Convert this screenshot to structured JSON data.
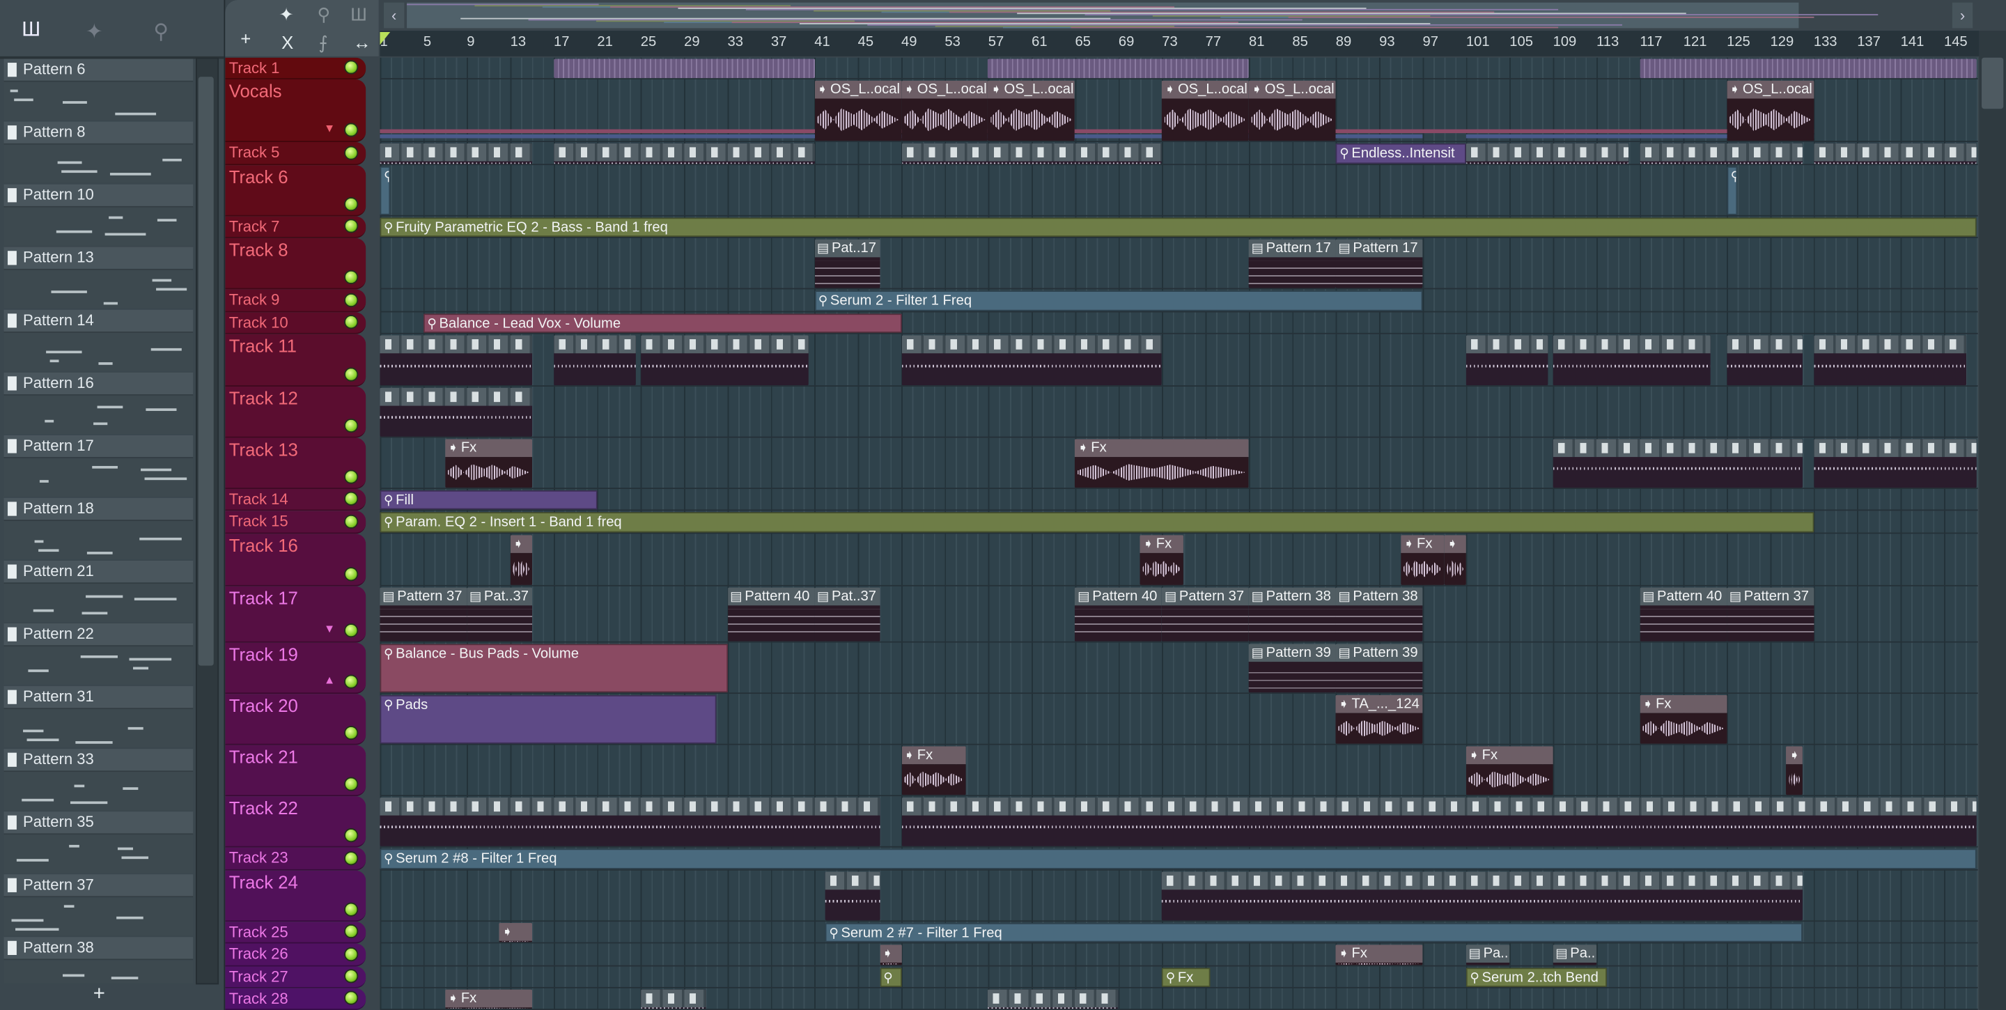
{
  "browser": {
    "tab_icons": [
      "piano-roll-icon",
      "audio-wave-icon",
      "automation-icon"
    ],
    "add_label": "+",
    "patterns": [
      "Pattern 6",
      "Pattern 8",
      "Pattern 10",
      "Pattern 13",
      "Pattern 14",
      "Pattern 16",
      "Pattern 17",
      "Pattern 18",
      "Pattern 21",
      "Pattern 22",
      "Pattern 31",
      "Pattern 33",
      "Pattern 35",
      "Pattern 37",
      "Pattern 38"
    ]
  },
  "toolbar": {
    "add": "+",
    "cut": "X",
    "slide": "⨍",
    "stretch": "↔",
    "wave": "✦",
    "auto": "⚲",
    "piano": "Ш",
    "scroll_left": "‹",
    "scroll_right": "›"
  },
  "ruler": {
    "labels": [
      1,
      5,
      9,
      13,
      17,
      21,
      25,
      29,
      33,
      37,
      41,
      45,
      49,
      53,
      57,
      61,
      65,
      69,
      73,
      77,
      81,
      85,
      89,
      93,
      97,
      101,
      105,
      109,
      113,
      117,
      121,
      125,
      129,
      133,
      137,
      141,
      145
    ]
  },
  "colors": {
    "auto_olive": "#6e7d47",
    "auto_steel": "#4a6a7e",
    "auto_pink": "#8a4a62",
    "auto_purple": "#5e4a86",
    "audio_strip": "#6a5a80"
  },
  "tracks": [
    {
      "name": "Track 1"
    },
    {
      "name": "Vocals",
      "arrow": "▼"
    },
    {
      "name": "Track 5"
    },
    {
      "name": "Track 6"
    },
    {
      "name": "Track 7"
    },
    {
      "name": "Track 8"
    },
    {
      "name": "Track 9"
    },
    {
      "name": "Track 10"
    },
    {
      "name": "Track 11"
    },
    {
      "name": "Track 12"
    },
    {
      "name": "Track 13"
    },
    {
      "name": "Track 14"
    },
    {
      "name": "Track 15"
    },
    {
      "name": "Track 16"
    },
    {
      "name": "Track 17",
      "arrow": "▼"
    },
    {
      "name": "Track 19",
      "arrow": "▲"
    },
    {
      "name": "Track 20"
    },
    {
      "name": "Track 21"
    },
    {
      "name": "Track 22"
    },
    {
      "name": "Track 23"
    },
    {
      "name": "Track 24"
    },
    {
      "name": "Track 25"
    },
    {
      "name": "Track 26"
    },
    {
      "name": "Track 27"
    },
    {
      "name": "Track 28"
    }
  ],
  "clips": [
    {
      "t": 0,
      "s": 17,
      "l": 24,
      "type": "strip",
      "label": ""
    },
    {
      "t": 0,
      "s": 57,
      "l": 24,
      "type": "strip",
      "label": ""
    },
    {
      "t": 0,
      "s": 117,
      "l": 31,
      "type": "strip",
      "label": ""
    },
    {
      "t": 1,
      "s": 41,
      "l": 8,
      "type": "audio",
      "label": "OS_L..ocal"
    },
    {
      "t": 1,
      "s": 49,
      "l": 8,
      "type": "audio",
      "label": "OS_L..ocal"
    },
    {
      "t": 1,
      "s": 57,
      "l": 8,
      "type": "audio",
      "label": "OS_L..ocal"
    },
    {
      "t": 1,
      "s": 73,
      "l": 8,
      "type": "audio",
      "label": "OS_L..ocal"
    },
    {
      "t": 1,
      "s": 81,
      "l": 8,
      "type": "audio",
      "label": "OS_L..ocal"
    },
    {
      "t": 1,
      "s": 125,
      "l": 8,
      "type": "audio",
      "label": "OS_L..ocal"
    },
    {
      "t": 2,
      "s": 1,
      "l": 14,
      "type": "blocks",
      "label": ""
    },
    {
      "t": 2,
      "s": 17,
      "l": 24,
      "type": "blocks",
      "label": ""
    },
    {
      "t": 2,
      "s": 49,
      "l": 24,
      "type": "blocks",
      "label": ""
    },
    {
      "t": 2,
      "s": 89,
      "l": 12,
      "type": "auto",
      "color": "auto_purple",
      "label": "Endless..Intensit"
    },
    {
      "t": 2,
      "s": 101,
      "l": 15,
      "type": "blocks",
      "label": ""
    },
    {
      "t": 2,
      "s": 117,
      "l": 15,
      "type": "blocks",
      "label": ""
    },
    {
      "t": 2,
      "s": 133,
      "l": 15,
      "type": "blocks",
      "label": ""
    },
    {
      "t": 3,
      "s": 1,
      "l": 1,
      "type": "auto",
      "color": "auto_steel",
      "label": ""
    },
    {
      "t": 3,
      "s": 125,
      "l": 1,
      "type": "auto",
      "color": "auto_steel",
      "label": ""
    },
    {
      "t": 4,
      "s": 1,
      "l": 147,
      "type": "auto",
      "color": "auto_olive",
      "label": "Fruity Parametric EQ 2 - Bass - Band 1 freq"
    },
    {
      "t": 5,
      "s": 41,
      "l": 6,
      "type": "pat",
      "label": "Pat..17"
    },
    {
      "t": 5,
      "s": 81,
      "l": 8,
      "type": "pat",
      "label": "Pattern 17"
    },
    {
      "t": 5,
      "s": 89,
      "l": 8,
      "type": "pat",
      "label": "Pattern 17"
    },
    {
      "t": 6,
      "s": 41,
      "l": 56,
      "type": "auto",
      "color": "auto_steel",
      "label": "Serum 2 - Filter 1 Freq"
    },
    {
      "t": 7,
      "s": 5,
      "l": 44,
      "type": "auto",
      "color": "auto_pink",
      "label": "Balance - Lead Vox - Volume"
    },
    {
      "t": 8,
      "s": 1,
      "l": 14,
      "type": "blocks",
      "label": ""
    },
    {
      "t": 8,
      "s": 17,
      "l": 7.5,
      "type": "blocks",
      "label": ""
    },
    {
      "t": 8,
      "s": 25,
      "l": 15.5,
      "type": "blocks",
      "label": ""
    },
    {
      "t": 8,
      "s": 49,
      "l": 24,
      "type": "blocks",
      "label": ""
    },
    {
      "t": 8,
      "s": 101,
      "l": 7.5,
      "type": "blocks",
      "label": ""
    },
    {
      "t": 8,
      "s": 109,
      "l": 14.5,
      "type": "blocks",
      "label": ""
    },
    {
      "t": 8,
      "s": 125,
      "l": 7,
      "type": "blocks",
      "label": ""
    },
    {
      "t": 8,
      "s": 133,
      "l": 14,
      "type": "blocks",
      "label": ""
    },
    {
      "t": 9,
      "s": 1,
      "l": 14,
      "type": "blocks",
      "label": ""
    },
    {
      "t": 10,
      "s": 7,
      "l": 8,
      "type": "audio",
      "label": "Fx"
    },
    {
      "t": 10,
      "s": 65,
      "l": 16,
      "type": "audio",
      "label": "Fx"
    },
    {
      "t": 10,
      "s": 109,
      "l": 23,
      "type": "blocks",
      "label": ""
    },
    {
      "t": 10,
      "s": 133,
      "l": 15,
      "type": "blocks",
      "label": ""
    },
    {
      "t": 11,
      "s": 1,
      "l": 20,
      "type": "auto",
      "color": "auto_purple",
      "label": "Fill"
    },
    {
      "t": 12,
      "s": 1,
      "l": 132,
      "type": "auto",
      "color": "auto_olive",
      "label": "Param. EQ 2 - Insert 1 - Band 1 freq"
    },
    {
      "t": 13,
      "s": 13,
      "l": 2,
      "type": "audio",
      "label": ""
    },
    {
      "t": 13,
      "s": 71,
      "l": 4,
      "type": "audio",
      "label": "Fx"
    },
    {
      "t": 13,
      "s": 95,
      "l": 4,
      "type": "audio",
      "label": "Fx"
    },
    {
      "t": 13,
      "s": 99,
      "l": 2,
      "type": "audio",
      "label": ""
    },
    {
      "t": 14,
      "s": 1,
      "l": 8,
      "type": "pat",
      "label": "Pattern 37"
    },
    {
      "t": 14,
      "s": 9,
      "l": 6,
      "type": "pat",
      "label": "Pat..37"
    },
    {
      "t": 14,
      "s": 33,
      "l": 8,
      "type": "pat",
      "label": "Pattern 40"
    },
    {
      "t": 14,
      "s": 41,
      "l": 6,
      "type": "pat",
      "label": "Pat..37"
    },
    {
      "t": 14,
      "s": 65,
      "l": 8,
      "type": "pat",
      "label": "Pattern 40"
    },
    {
      "t": 14,
      "s": 73,
      "l": 8,
      "type": "pat",
      "label": "Pattern 37"
    },
    {
      "t": 14,
      "s": 81,
      "l": 8,
      "type": "pat",
      "label": "Pattern 38"
    },
    {
      "t": 14,
      "s": 89,
      "l": 8,
      "type": "pat",
      "label": "Pattern 38"
    },
    {
      "t": 14,
      "s": 117,
      "l": 8,
      "type": "pat",
      "label": "Pattern 40"
    },
    {
      "t": 14,
      "s": 125,
      "l": 8,
      "type": "pat",
      "label": "Pattern 37"
    },
    {
      "t": 15,
      "s": 1,
      "l": 32,
      "type": "auto",
      "color": "auto_pink",
      "label": "Balance - Bus Pads - Volume"
    },
    {
      "t": 15,
      "s": 81,
      "l": 8,
      "type": "pat",
      "label": "Pattern 39"
    },
    {
      "t": 15,
      "s": 89,
      "l": 8,
      "type": "pat",
      "label": "Pattern 39"
    },
    {
      "t": 16,
      "s": 1,
      "l": 31,
      "type": "auto",
      "color": "auto_purple",
      "label": "Pads"
    },
    {
      "t": 16,
      "s": 89,
      "l": 8,
      "type": "audio",
      "label": "TA_..._124"
    },
    {
      "t": 16,
      "s": 117,
      "l": 8,
      "type": "audio",
      "label": "Fx"
    },
    {
      "t": 17,
      "s": 49,
      "l": 6,
      "type": "audio",
      "label": "Fx"
    },
    {
      "t": 17,
      "s": 101,
      "l": 8,
      "type": "audio",
      "label": "Fx"
    },
    {
      "t": 17,
      "s": 130.5,
      "l": 1.5,
      "type": "audio",
      "label": ""
    },
    {
      "t": 18,
      "s": 1,
      "l": 46,
      "type": "blocks",
      "label": ""
    },
    {
      "t": 18,
      "s": 49,
      "l": 99,
      "type": "blocks",
      "label": ""
    },
    {
      "t": 19,
      "s": 1,
      "l": 147,
      "type": "auto",
      "color": "auto_steel",
      "label": "Serum 2 #8 - Filter 1 Freq"
    },
    {
      "t": 20,
      "s": 42,
      "l": 5,
      "type": "blocks",
      "label": ""
    },
    {
      "t": 20,
      "s": 73,
      "l": 59,
      "type": "blocks",
      "label": ""
    },
    {
      "t": 21,
      "s": 12,
      "l": 3,
      "type": "audio",
      "label": ""
    },
    {
      "t": 21,
      "s": 42,
      "l": 90,
      "type": "auto",
      "color": "auto_steel",
      "label": "Serum 2 #7 - Filter 1 Freq"
    },
    {
      "t": 22,
      "s": 47,
      "l": 2,
      "type": "audio",
      "label": ""
    },
    {
      "t": 22,
      "s": 89,
      "l": 8,
      "type": "audio",
      "label": "Fx"
    },
    {
      "t": 22,
      "s": 101,
      "l": 4,
      "type": "pat",
      "label": "Pa.."
    },
    {
      "t": 22,
      "s": 109,
      "l": 4,
      "type": "pat",
      "label": "Pa.."
    },
    {
      "t": 23,
      "s": 47,
      "l": 2,
      "type": "auto",
      "color": "auto_olive",
      "label": ""
    },
    {
      "t": 23,
      "s": 73,
      "l": 4.5,
      "type": "auto",
      "color": "auto_olive",
      "label": "Fx"
    },
    {
      "t": 23,
      "s": 101,
      "l": 13,
      "type": "auto",
      "color": "auto_olive",
      "label": "Serum 2..tch Bend"
    },
    {
      "t": 24,
      "s": 7,
      "l": 8,
      "type": "audio",
      "label": "Fx"
    },
    {
      "t": 24,
      "s": 25,
      "l": 6,
      "type": "blocks",
      "label": ""
    },
    {
      "t": 24,
      "s": 57,
      "l": 12,
      "type": "blocks",
      "label": ""
    }
  ]
}
